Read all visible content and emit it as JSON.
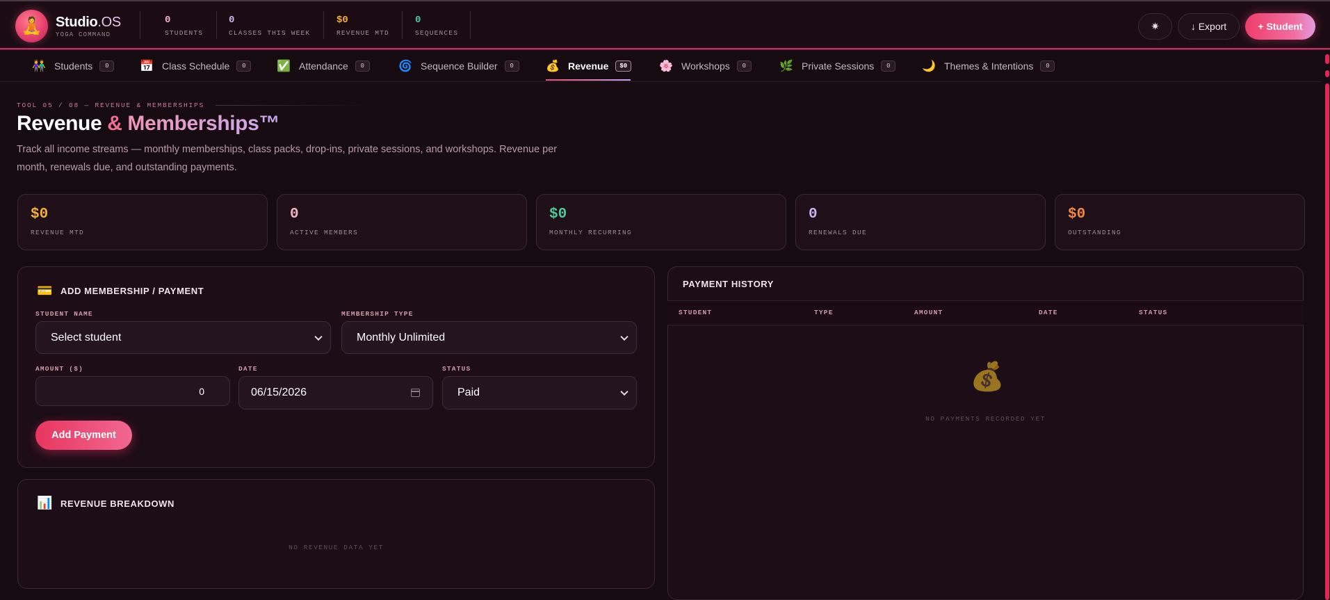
{
  "brand": {
    "name_main": "Studio",
    "name_suffix": ".OS",
    "subtitle": "YOGA COMMAND",
    "logo_icon": "meditating-person-icon"
  },
  "header_stats": [
    {
      "value": "0",
      "label": "STUDENTS",
      "color": "#f3b1c4"
    },
    {
      "value": "0",
      "label": "CLASSES THIS WEEK",
      "color": "#c9b3f2"
    },
    {
      "value": "$0",
      "label": "REVENUE MTD",
      "color": "#f5b133"
    },
    {
      "value": "0",
      "label": "SEQUENCES",
      "color": "#4cc99a"
    }
  ],
  "header_actions": {
    "theme_icon": "sun-icon",
    "export_label": "↓ Export",
    "add_student_label": "+ Student"
  },
  "tabs": [
    {
      "label": "Students",
      "badge": "0",
      "icon": "people-icon",
      "glyph": "👫",
      "active": false
    },
    {
      "label": "Class Schedule",
      "badge": "0",
      "icon": "calendar-icon",
      "glyph": "📅",
      "active": false
    },
    {
      "label": "Attendance",
      "badge": "0",
      "icon": "checkmark-icon",
      "glyph": "✅",
      "active": false
    },
    {
      "label": "Sequence Builder",
      "badge": "0",
      "icon": "spiral-icon",
      "glyph": "🌀",
      "active": false
    },
    {
      "label": "Revenue",
      "badge": "$0",
      "icon": "money-bag-icon",
      "glyph": "💰",
      "active": true
    },
    {
      "label": "Workshops",
      "badge": "0",
      "icon": "flower-icon",
      "glyph": "🌸",
      "active": false
    },
    {
      "label": "Private Sessions",
      "badge": "0",
      "icon": "herb-icon",
      "glyph": "🌿",
      "active": false
    },
    {
      "label": "Themes & Intentions",
      "badge": "0",
      "icon": "moon-icon",
      "glyph": "🌙",
      "active": false
    }
  ],
  "page": {
    "eyebrow": "TOOL 05 / 08 — REVENUE & MEMBERSHIPS",
    "title_main": "Revenue",
    "title_amp": " & ",
    "title_accent": "Memberships™",
    "description": "Track all income streams — monthly memberships, class packs, drop-ins, private sessions, and workshops. Revenue per month, renewals due, and outstanding payments."
  },
  "metrics": [
    {
      "value": "$0",
      "label": "REVENUE MTD",
      "color": "#f5b133"
    },
    {
      "value": "0",
      "label": "ACTIVE MEMBERS",
      "color": "#f3b1c4"
    },
    {
      "value": "$0",
      "label": "MONTHLY RECURRING",
      "color": "#4cc99a"
    },
    {
      "value": "0",
      "label": "RENEWALS DUE",
      "color": "#c9b3f2"
    },
    {
      "value": "$0",
      "label": "OUTSTANDING",
      "color": "#f28a3c"
    }
  ],
  "add_payment": {
    "title": "ADD MEMBERSHIP / PAYMENT",
    "icon": "credit-card-icon",
    "student_label": "STUDENT NAME",
    "student_value": "Select student",
    "membership_label": "MEMBERSHIP TYPE",
    "membership_value": "Monthly Unlimited",
    "amount_label": "AMOUNT ($)",
    "amount_value": "0",
    "date_label": "DATE",
    "date_value": "06/15/2026",
    "status_label": "STATUS",
    "status_value": "Paid",
    "submit_label": "Add Payment"
  },
  "revenue_breakdown": {
    "title": "REVENUE BREAKDOWN",
    "icon": "bar-chart-icon",
    "empty": "NO REVENUE DATA YET"
  },
  "payment_history": {
    "title": "PAYMENT HISTORY",
    "columns": [
      "STUDENT",
      "TYPE",
      "AMOUNT",
      "DATE",
      "STATUS"
    ],
    "empty_icon": "money-bag-icon",
    "empty": "NO PAYMENTS RECORDED YET"
  }
}
